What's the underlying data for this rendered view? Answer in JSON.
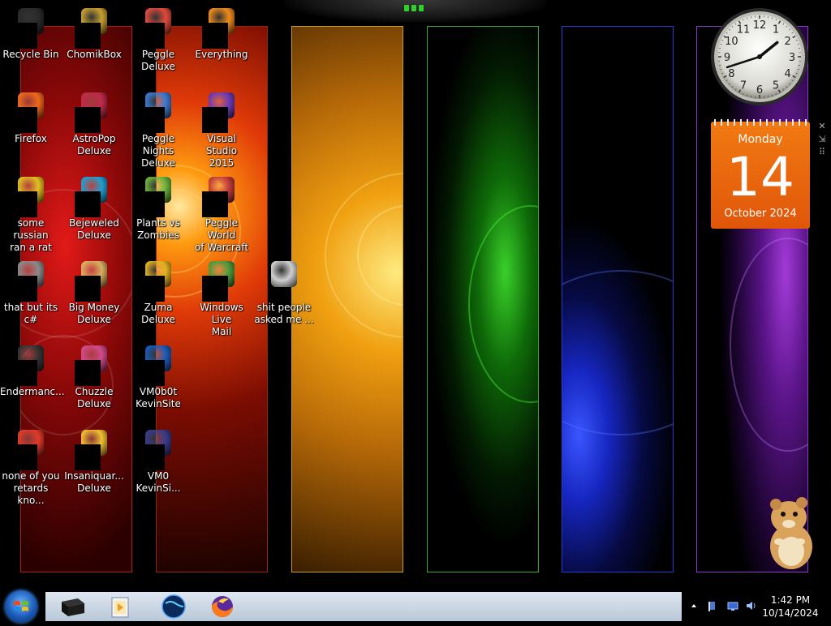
{
  "desktop": {
    "icons": [
      {
        "id": "recycle-bin",
        "label": "Recycle Bin",
        "x": 0,
        "y": 0
      },
      {
        "id": "chomikbox",
        "label": "ChomikBox",
        "x": 1,
        "y": 0
      },
      {
        "id": "peggle-deluxe",
        "label": "Peggle Deluxe",
        "x": 2,
        "y": 0
      },
      {
        "id": "everything",
        "label": "Everything",
        "x": 3,
        "y": 0
      },
      {
        "id": "firefox",
        "label": "Firefox",
        "x": 0,
        "y": 1
      },
      {
        "id": "astropop",
        "label": "AstroPop\nDeluxe",
        "x": 1,
        "y": 1
      },
      {
        "id": "peggle-nights",
        "label": "Peggle Nights\nDeluxe",
        "x": 2,
        "y": 1
      },
      {
        "id": "visual-studio",
        "label": "Visual Studio\n2015",
        "x": 3,
        "y": 1
      },
      {
        "id": "some-russian",
        "label": "some russian\nran a rat",
        "x": 0,
        "y": 2
      },
      {
        "id": "bejeweled",
        "label": "Bejeweled\nDeluxe",
        "x": 1,
        "y": 2
      },
      {
        "id": "plants-vs-zombies",
        "label": "Plants vs\nZombies",
        "x": 2,
        "y": 2
      },
      {
        "id": "peggle-world",
        "label": "Peggle World\nof Warcraft ...",
        "x": 3,
        "y": 2
      },
      {
        "id": "that-but-its-cs",
        "label": "that but its c#",
        "x": 0,
        "y": 3
      },
      {
        "id": "big-money",
        "label": "Big Money\nDeluxe",
        "x": 1,
        "y": 3
      },
      {
        "id": "zuma-deluxe",
        "label": "Zuma Deluxe",
        "x": 2,
        "y": 3
      },
      {
        "id": "windows-live-mail",
        "label": "Windows Live\nMail",
        "x": 3,
        "y": 3
      },
      {
        "id": "shit-people",
        "label": "shit people\nasked me ...",
        "x": 4,
        "y": 3
      },
      {
        "id": "endermanch",
        "label": "Endermanc...",
        "x": 0,
        "y": 4
      },
      {
        "id": "chuzzle",
        "label": "Chuzzle\nDeluxe",
        "x": 1,
        "y": 4
      },
      {
        "id": "vm0b0t-kevinsite",
        "label": "VM0b0t\nKevinSite",
        "x": 2,
        "y": 4
      },
      {
        "id": "none-of-you",
        "label": "none of you\nretards kno...",
        "x": 0,
        "y": 5
      },
      {
        "id": "insaniquarium",
        "label": "Insaniquar...\nDeluxe",
        "x": 1,
        "y": 5
      },
      {
        "id": "vm0-kevinsi",
        "label": "VM0\nKevinSi...",
        "x": 2,
        "y": 5
      }
    ]
  },
  "gadgets": {
    "clock": {
      "hour": 1,
      "minute": 42
    },
    "calendar": {
      "weekday": "Monday",
      "day": "14",
      "month_year": "October 2024"
    },
    "tools": {
      "close": "✕",
      "drag": "⇲",
      "grip": "⠿"
    }
  },
  "taskbar": {
    "pinned": [
      {
        "id": "explorer",
        "icon": "black-box-icon"
      },
      {
        "id": "media-player",
        "icon": "media-player-icon"
      },
      {
        "id": "earth",
        "icon": "globe-icon"
      },
      {
        "id": "firefox",
        "icon": "firefox-icon"
      }
    ],
    "clock": {
      "time": "1:42 PM",
      "date": "10/14/2024"
    }
  }
}
